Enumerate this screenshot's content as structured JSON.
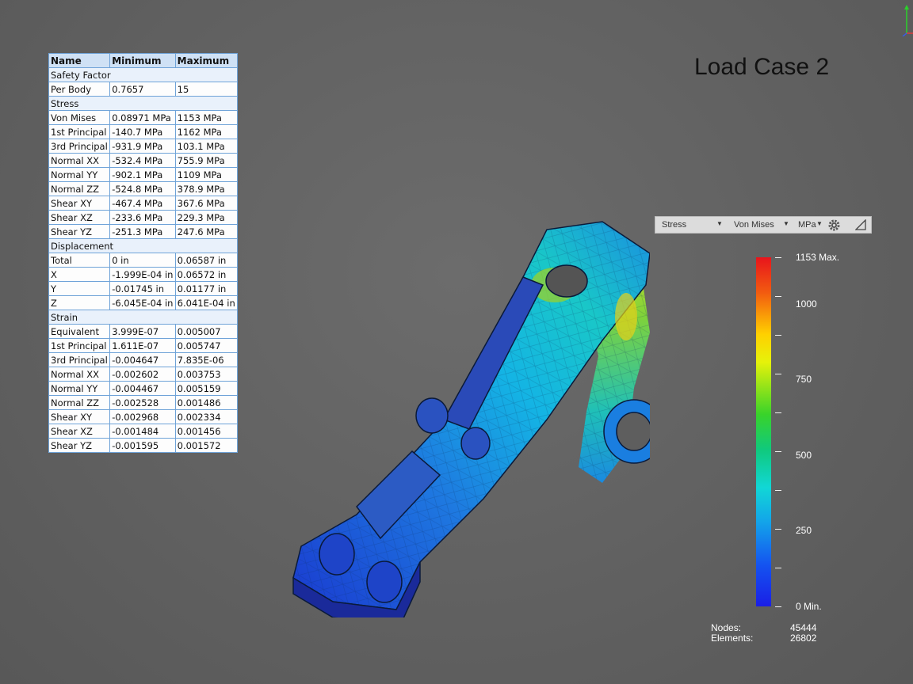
{
  "title": "Load Case 2",
  "table": {
    "headers": [
      "Name",
      "Minimum",
      "Maximum"
    ],
    "rows": [
      {
        "category": "Safety Factor"
      },
      {
        "name": "Per Body",
        "min": "0.7657",
        "max": "15"
      },
      {
        "category": "Stress"
      },
      {
        "name": "Von Mises",
        "min": "0.08971 MPa",
        "max": "1153 MPa"
      },
      {
        "name": "1st Principal",
        "min": "-140.7 MPa",
        "max": "1162 MPa"
      },
      {
        "name": "3rd Principal",
        "min": "-931.9 MPa",
        "max": "103.1 MPa"
      },
      {
        "name": "Normal XX",
        "min": "-532.4 MPa",
        "max": "755.9 MPa"
      },
      {
        "name": "Normal YY",
        "min": "-902.1 MPa",
        "max": "1109 MPa"
      },
      {
        "name": "Normal ZZ",
        "min": "-524.8 MPa",
        "max": "378.9 MPa"
      },
      {
        "name": "Shear XY",
        "min": "-467.4 MPa",
        "max": "367.6 MPa"
      },
      {
        "name": "Shear XZ",
        "min": "-233.6 MPa",
        "max": "229.3 MPa"
      },
      {
        "name": "Shear YZ",
        "min": "-251.3 MPa",
        "max": "247.6 MPa"
      },
      {
        "category": "Displacement"
      },
      {
        "name": "Total",
        "min": "0 in",
        "max": "0.06587 in"
      },
      {
        "name": "X",
        "min": "-1.999E-04 in",
        "max": "0.06572 in"
      },
      {
        "name": "Y",
        "min": "-0.01745 in",
        "max": "0.01177 in"
      },
      {
        "name": "Z",
        "min": "-6.045E-04 in",
        "max": "6.041E-04 in"
      },
      {
        "category": "Strain"
      },
      {
        "name": "Equivalent",
        "min": "3.999E-07",
        "max": "0.005007"
      },
      {
        "name": "1st Principal",
        "min": "1.611E-07",
        "max": "0.005747"
      },
      {
        "name": "3rd Principal",
        "min": "-0.004647",
        "max": "7.835E-06"
      },
      {
        "name": "Normal XX",
        "min": "-0.002602",
        "max": "0.003753"
      },
      {
        "name": "Normal YY",
        "min": "-0.004467",
        "max": "0.005159"
      },
      {
        "name": "Normal ZZ",
        "min": "-0.002528",
        "max": "0.001486"
      },
      {
        "name": "Shear XY",
        "min": "-0.002968",
        "max": "0.002334"
      },
      {
        "name": "Shear XZ",
        "min": "-0.001484",
        "max": "0.001456"
      },
      {
        "name": "Shear YZ",
        "min": "-0.001595",
        "max": "0.001572"
      }
    ]
  },
  "legend_toolbar": {
    "result_type": "Stress",
    "result_component": "Von Mises",
    "units": "MPa",
    "settings_icon": "gear-icon",
    "probe_icon": "triangle-probe-icon"
  },
  "color_bar": {
    "max_label": "1153 Max.",
    "min_label": "0 Min.",
    "labels": [
      {
        "value": 1000,
        "text": "1000"
      },
      {
        "value": 750,
        "text": "750"
      },
      {
        "value": 500,
        "text": "500"
      },
      {
        "value": 250,
        "text": "250"
      }
    ],
    "range": [
      0,
      1153
    ]
  },
  "mesh": {
    "nodes_label": "Nodes:",
    "nodes_value": "45444",
    "elements_label": "Elements:",
    "elements_value": "26802"
  },
  "colors": {
    "background": "#616161",
    "table_border": "#6fa3d8",
    "table_header": "#cfe1f5"
  }
}
